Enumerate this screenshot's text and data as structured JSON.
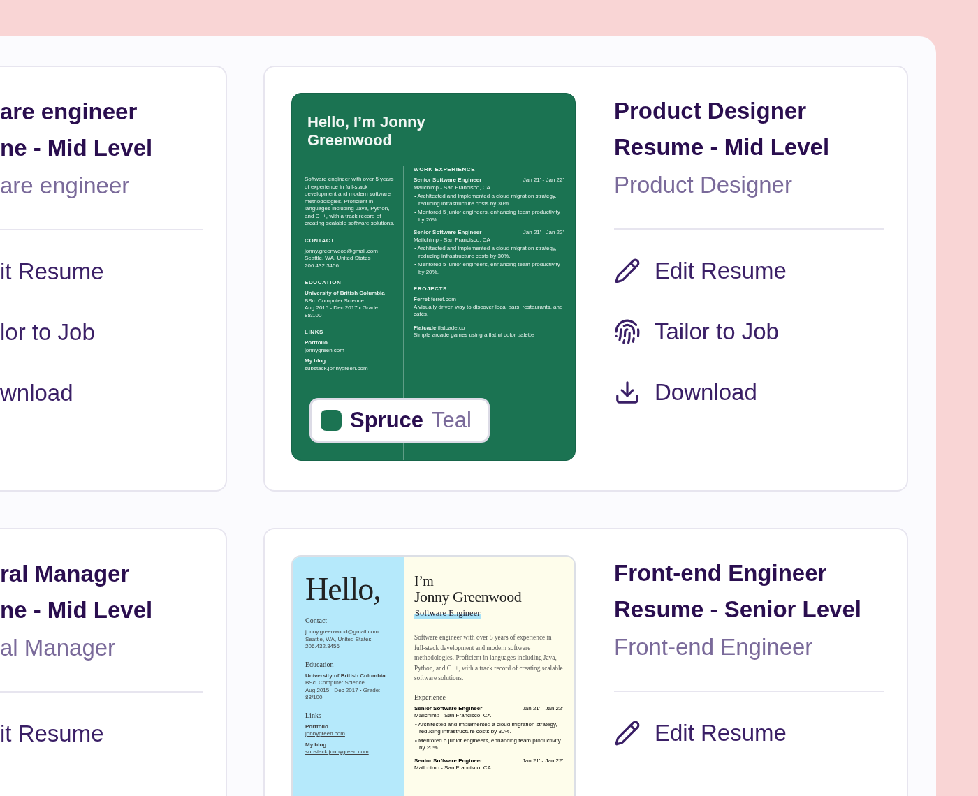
{
  "rows": [
    {
      "side": {
        "title_lines": [
          "are engineer",
          "ne - Mid Level"
        ],
        "role": "are engineer",
        "actions": [
          "it Resume",
          "lor to Job",
          "wnload"
        ]
      },
      "main": {
        "title_lines": [
          "Product Designer",
          "Resume - Mid Level"
        ],
        "role": "Product Designer",
        "actions": [
          {
            "kind": "edit",
            "label": "Edit Resume"
          },
          {
            "kind": "tailor",
            "label": "Tailor to Job"
          },
          {
            "kind": "download",
            "label": "Download"
          }
        ],
        "preview": {
          "kind": "modern",
          "greeting": "Hello, I’m Jonny Greenwood",
          "summary": "Software engineer with over 5 years of experience in full-stack development and modern software methodologies. Proficient in languages including Java, Python, and C++, with a track record of creating scalable software solutions.",
          "contact": {
            "heading": "CONTACT",
            "lines": [
              "jonny.greenwood@gmail.com",
              "Seattle, WA, United States",
              "206.432.3456"
            ]
          },
          "education": {
            "heading": "EDUCATION",
            "school": "University of British Columbia",
            "degree": "BSc. Computer Science",
            "dates": "Aug 2015 - Dec 2017 • Grade: 88/100"
          },
          "links": {
            "heading": "LINKS",
            "items": [
              {
                "label": "Portfolio",
                "url": "jonnygreen.com"
              },
              {
                "label": "My blog",
                "url": "substack.jonnygreen.com"
              }
            ]
          },
          "experience": {
            "heading": "WORK EXPERIENCE",
            "jobs": [
              {
                "title": "Senior Software Engineer",
                "dates": "Jan 21' - Jan 22'",
                "company": "Mailchimp - San Francisco, CA",
                "bullets": [
                  "• Architected and implemented a cloud migration strategy, reducing infrastructure costs by 30%.",
                  "• Mentored 5 junior engineers, enhancing team productivity by 20%."
                ]
              },
              {
                "title": "Senior Software Engineer",
                "dates": "Jan 21' - Jan 22'",
                "company": "Mailchimp - San Francisco, CA",
                "bullets": [
                  "• Architected and implemented a cloud migration strategy, reducing infrastructure costs by 30%.",
                  "• Mentored 5 junior engineers, enhancing team productivity by 20%."
                ]
              }
            ]
          },
          "projects": {
            "heading": "PROJECTS",
            "items": [
              {
                "name": "Ferret",
                "url": "ferret.com",
                "desc": "A visually driven way to discover local bars, restaurants, and cafés."
              },
              {
                "name": "Flatcade",
                "url": "flatcade.co",
                "desc": "Simple arcade games using a flat ui color palette"
              }
            ]
          },
          "template": {
            "name": "Spruce",
            "variant": "Teal",
            "color": "#1b7352"
          }
        }
      }
    },
    {
      "side": {
        "title_lines": [
          "ral Manager",
          "ne - Mid Level"
        ],
        "role": "al Manager",
        "actions": [
          "it Resume"
        ]
      },
      "main": {
        "title_lines": [
          "Front-end Engineer",
          "Resume - Senior Level"
        ],
        "role": "Front-end Engineer",
        "actions": [
          {
            "kind": "edit",
            "label": "Edit Resume"
          }
        ],
        "preview": {
          "kind": "serif",
          "greeting": "Hello,",
          "intro": "I’m",
          "name": "Jonny Greenwood",
          "headline": "Software Engineer",
          "summary": "Software engineer with over 5 years of experience in full-stack development and modern software methodologies. Proficient in languages including Java, Python, and C++, with a track record of creating scalable software solutions.",
          "contact": {
            "heading": "Contact",
            "lines": [
              "jonny.greenwood@gmail.com",
              "Seattle, WA, United States",
              "206.432.3456"
            ]
          },
          "education": {
            "heading": "Education",
            "school": "University of British Columbia",
            "degree": "BSc. Computer Science",
            "dates": "Aug 2015 - Dec 2017 • Grade: 88/100"
          },
          "links": {
            "heading": "Links",
            "items": [
              {
                "label": "Portfolio",
                "url": "jonnygreen.com"
              },
              {
                "label": "My blog",
                "url": "substack.jonnygreen.com"
              }
            ]
          },
          "experience": {
            "heading": "Experience",
            "jobs": [
              {
                "title": "Senior Software Engineer",
                "dates": "Jan 21' - Jan 22'",
                "company": "Mailchimp - San Francisco, CA",
                "bullets": [
                  "• Architected and implemented a cloud migration strategy, reducing infrastructure costs by 30%.",
                  "• Mentored 5 junior engineers, enhancing team productivity by 20%."
                ]
              },
              {
                "title": "Senior Software Engineer",
                "dates": "Jan 21' - Jan 22'",
                "company": "Mailchimp - San Francisco, CA"
              }
            ]
          }
        }
      }
    }
  ]
}
